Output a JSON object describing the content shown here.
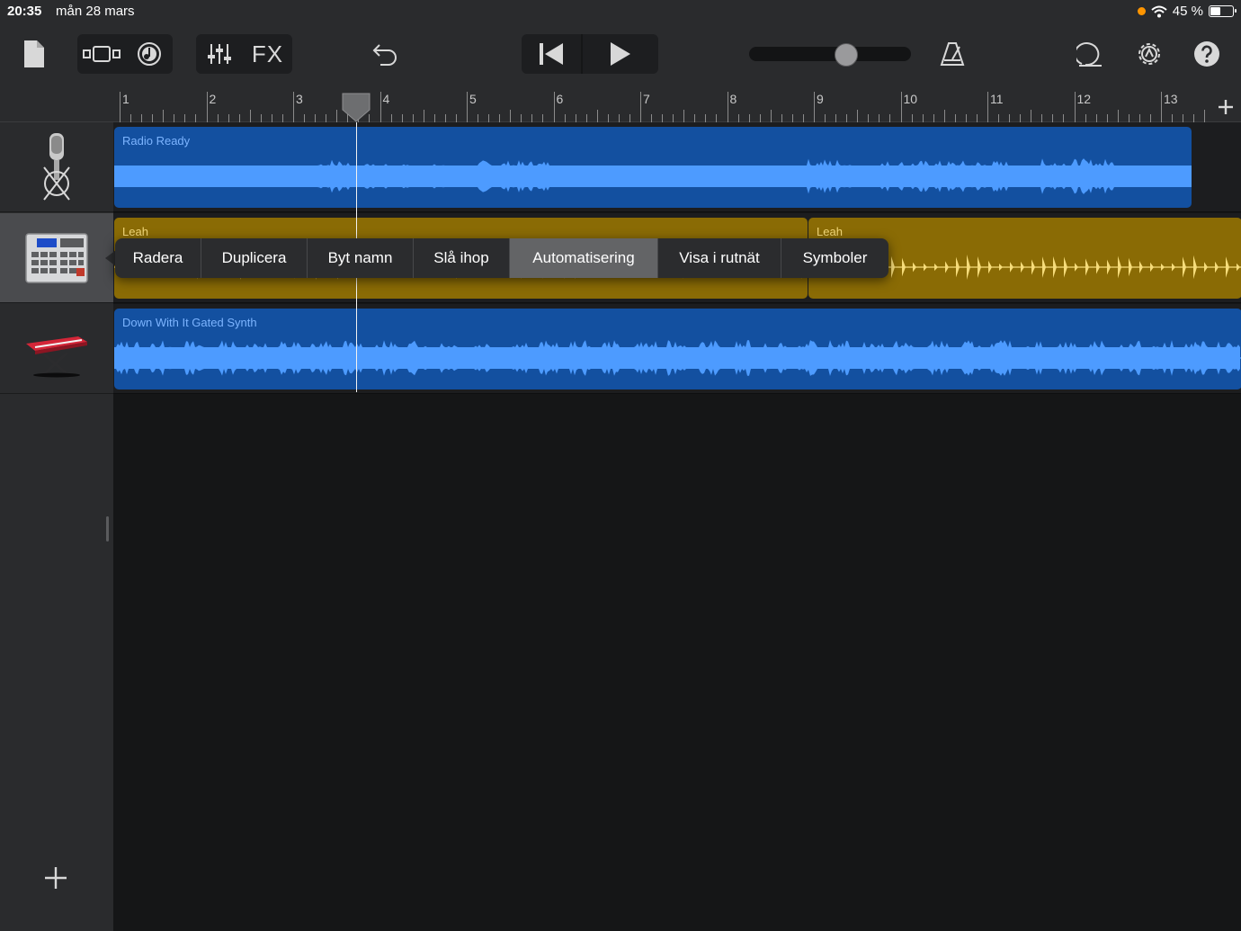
{
  "status_bar": {
    "time": "20:35",
    "date": "mån 28 mars",
    "battery": "45 %",
    "battery_level": 0.45
  },
  "toolbar": {
    "fx_label": "FX",
    "volume_level": 0.6,
    "icons": [
      "document-icon",
      "tracks-view-icon",
      "live-loops-icon",
      "mixer-icon",
      "undo-icon",
      "go-to-start-icon",
      "play-icon",
      "metronome-icon",
      "loop-browser-icon",
      "settings-icon",
      "help-icon"
    ]
  },
  "ruler": {
    "bars": [
      "1",
      "2",
      "3",
      "4",
      "5",
      "6",
      "7",
      "8",
      "9",
      "10",
      "11",
      "12",
      "13"
    ],
    "playhead_bar": 3.8
  },
  "tracks": [
    {
      "instrument": "microphone",
      "regions": [
        {
          "name": "Radio Ready",
          "start_bar": 1.0,
          "end_bar": 13.43
        }
      ]
    },
    {
      "instrument": "drum-machine",
      "selected": true,
      "regions": [
        {
          "name": "Leah",
          "start_bar": 1.0,
          "end_bar": 9.0
        },
        {
          "name": "Leah",
          "start_bar": 9.0,
          "end_bar": 14.0
        }
      ]
    },
    {
      "instrument": "keyboard-synth",
      "regions": [
        {
          "name": "Down With It Gated Synth",
          "start_bar": 1.0,
          "end_bar": 14.0
        }
      ]
    }
  ],
  "context_menu": {
    "items": [
      "Radera",
      "Duplicera",
      "Byt namn",
      "Slå ihop",
      "Automatisering",
      "Visa i rutnät",
      "Symboler"
    ],
    "active_index": 4
  },
  "colors": {
    "audio_region": "#1350a0",
    "drummer_region": "#8a6b05",
    "audio_wave": "#4d9bff",
    "drummer_wave": "#f6dc7a",
    "record_dot": "#ff9500"
  }
}
